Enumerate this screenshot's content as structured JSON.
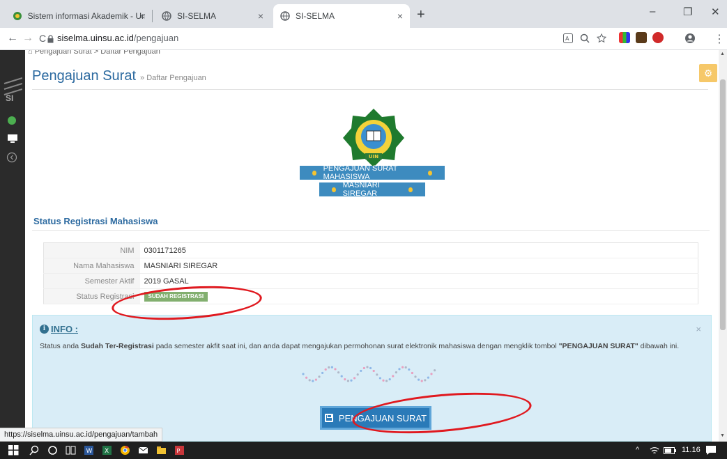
{
  "browser": {
    "tabs": [
      {
        "title": "Sistem informasi Akademik - Uni",
        "active": false
      },
      {
        "title": "SI-SELMA",
        "active": false
      },
      {
        "title": "SI-SELMA",
        "active": true
      }
    ],
    "tab_close": "×",
    "new_tab": "+",
    "window": {
      "minimize": "–",
      "restore": "❐",
      "close": "✕"
    },
    "nav": {
      "back": "←",
      "forward": "→",
      "reload": "C"
    },
    "url_host": "siselma.uinsu.ac.id",
    "url_path": "/pengajuan",
    "status_url": "https://siselma.uinsu.ac.id/pengajuan/tambah",
    "menu": "⋮"
  },
  "sidebar": {
    "logo_text": "SI"
  },
  "page": {
    "breadcrumb": "Pengajuan Surat  >  Daftar Pengajuan",
    "title": "Pengajuan Surat",
    "subtitle": "» Daftar Pengajuan",
    "ribbon_main": "PENGAJUAN SURAT MAHASISWA",
    "ribbon_name": "MASNIARI SIREGAR",
    "logo_text": "UIN"
  },
  "status": {
    "section_title": "Status Registrasi Mahasiswa",
    "rows": [
      {
        "label": "NIM",
        "value": "0301171265"
      },
      {
        "label": "Nama Mahasiswa",
        "value": "MASNIARI SIREGAR"
      },
      {
        "label": "Semester Aktif",
        "value": "2019 GASAL"
      },
      {
        "label": "Status Registrasi",
        "value": "SUDAH REGISTRASI"
      }
    ]
  },
  "info": {
    "heading": "INFO :",
    "close": "×",
    "msg_1": "Status anda ",
    "msg_2": "Sudah Ter-Registrasi",
    "msg_3": " pada semester akfit saat ini, dan anda dapat mengajukan permohonan surat elektronik mahasiswa dengan mengklik tombol ",
    "msg_4": "\"PENGAJUAN SURAT\"",
    "msg_5": " dibawah ini.",
    "button_label": "PENGAJUAN SURAT"
  },
  "taskbar": {
    "clock": "11.16",
    "tray": "^"
  },
  "colors": {
    "accent": "#2c6aa0",
    "ribbon": "#3d8bbf",
    "badge": "#82af6f",
    "alert_bg": "#d9edf7",
    "annotation": "#e0191f"
  }
}
